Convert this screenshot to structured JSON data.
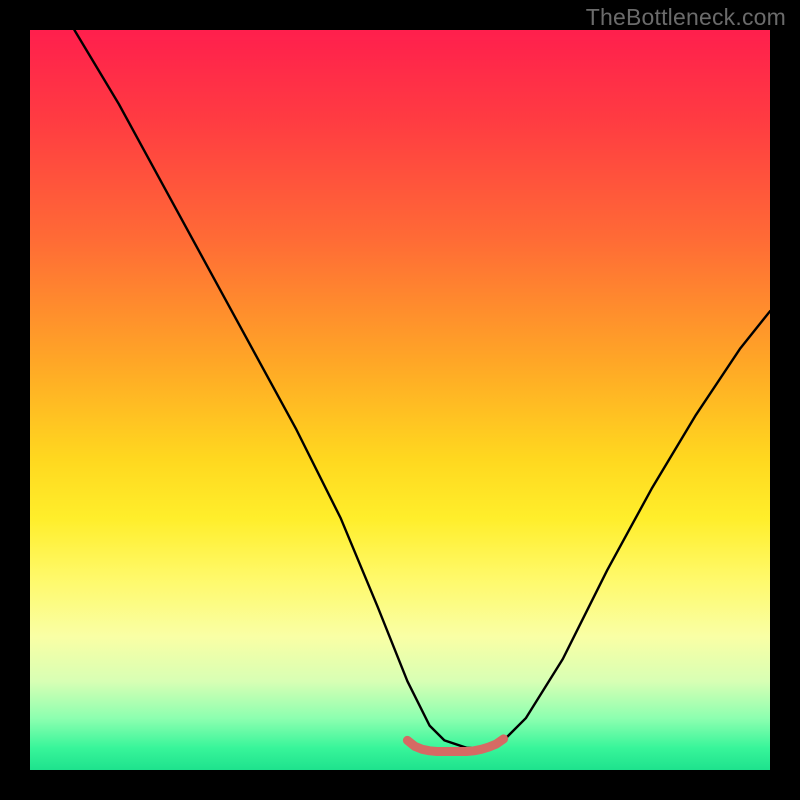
{
  "watermark": "TheBottleneck.com",
  "colors": {
    "top": "#ff1f4d",
    "mid_upper": "#ff6a36",
    "mid": "#ffd81f",
    "mid_lower": "#fff969",
    "bottom": "#1ee28d",
    "curve_stroke": "#000000",
    "bottom_marker": "#d66a64",
    "background": "#000000"
  },
  "chart_data": {
    "type": "line",
    "title": "",
    "xlabel": "",
    "ylabel": "",
    "xlim": [
      0,
      100
    ],
    "ylim": [
      0,
      100
    ],
    "series": [
      {
        "name": "main-curve",
        "x": [
          6,
          12,
          18,
          24,
          30,
          36,
          42,
          47,
          51,
          54,
          56,
          59,
          62,
          64,
          67,
          72,
          78,
          84,
          90,
          96,
          100
        ],
        "y": [
          100,
          90,
          79,
          68,
          57,
          46,
          34,
          22,
          12,
          6,
          4,
          3,
          3,
          4,
          7,
          15,
          27,
          38,
          48,
          57,
          62
        ]
      },
      {
        "name": "bottom-marker",
        "x": [
          51,
          52,
          53,
          54,
          55,
          56,
          57,
          58,
          59,
          60,
          61,
          62,
          63,
          64
        ],
        "y": [
          4.0,
          3.2,
          2.8,
          2.6,
          2.5,
          2.5,
          2.5,
          2.5,
          2.5,
          2.6,
          2.8,
          3.1,
          3.5,
          4.2
        ]
      }
    ]
  }
}
